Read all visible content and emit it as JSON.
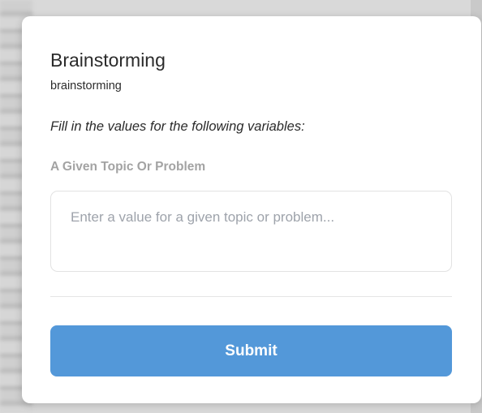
{
  "modal": {
    "title": "Brainstorming",
    "subtitle": "brainstorming",
    "instruction": "Fill in the values for the following variables:"
  },
  "variable": {
    "label": "A Given Topic Or Problem",
    "value": "",
    "placeholder": "Enter a value for a given topic or problem..."
  },
  "actions": {
    "submit_label": "Submit"
  },
  "colors": {
    "accent": "#5398d9",
    "label_gray": "#a3a3a3",
    "text": "#2b2b2b",
    "backdrop": "#d9d9d9"
  }
}
